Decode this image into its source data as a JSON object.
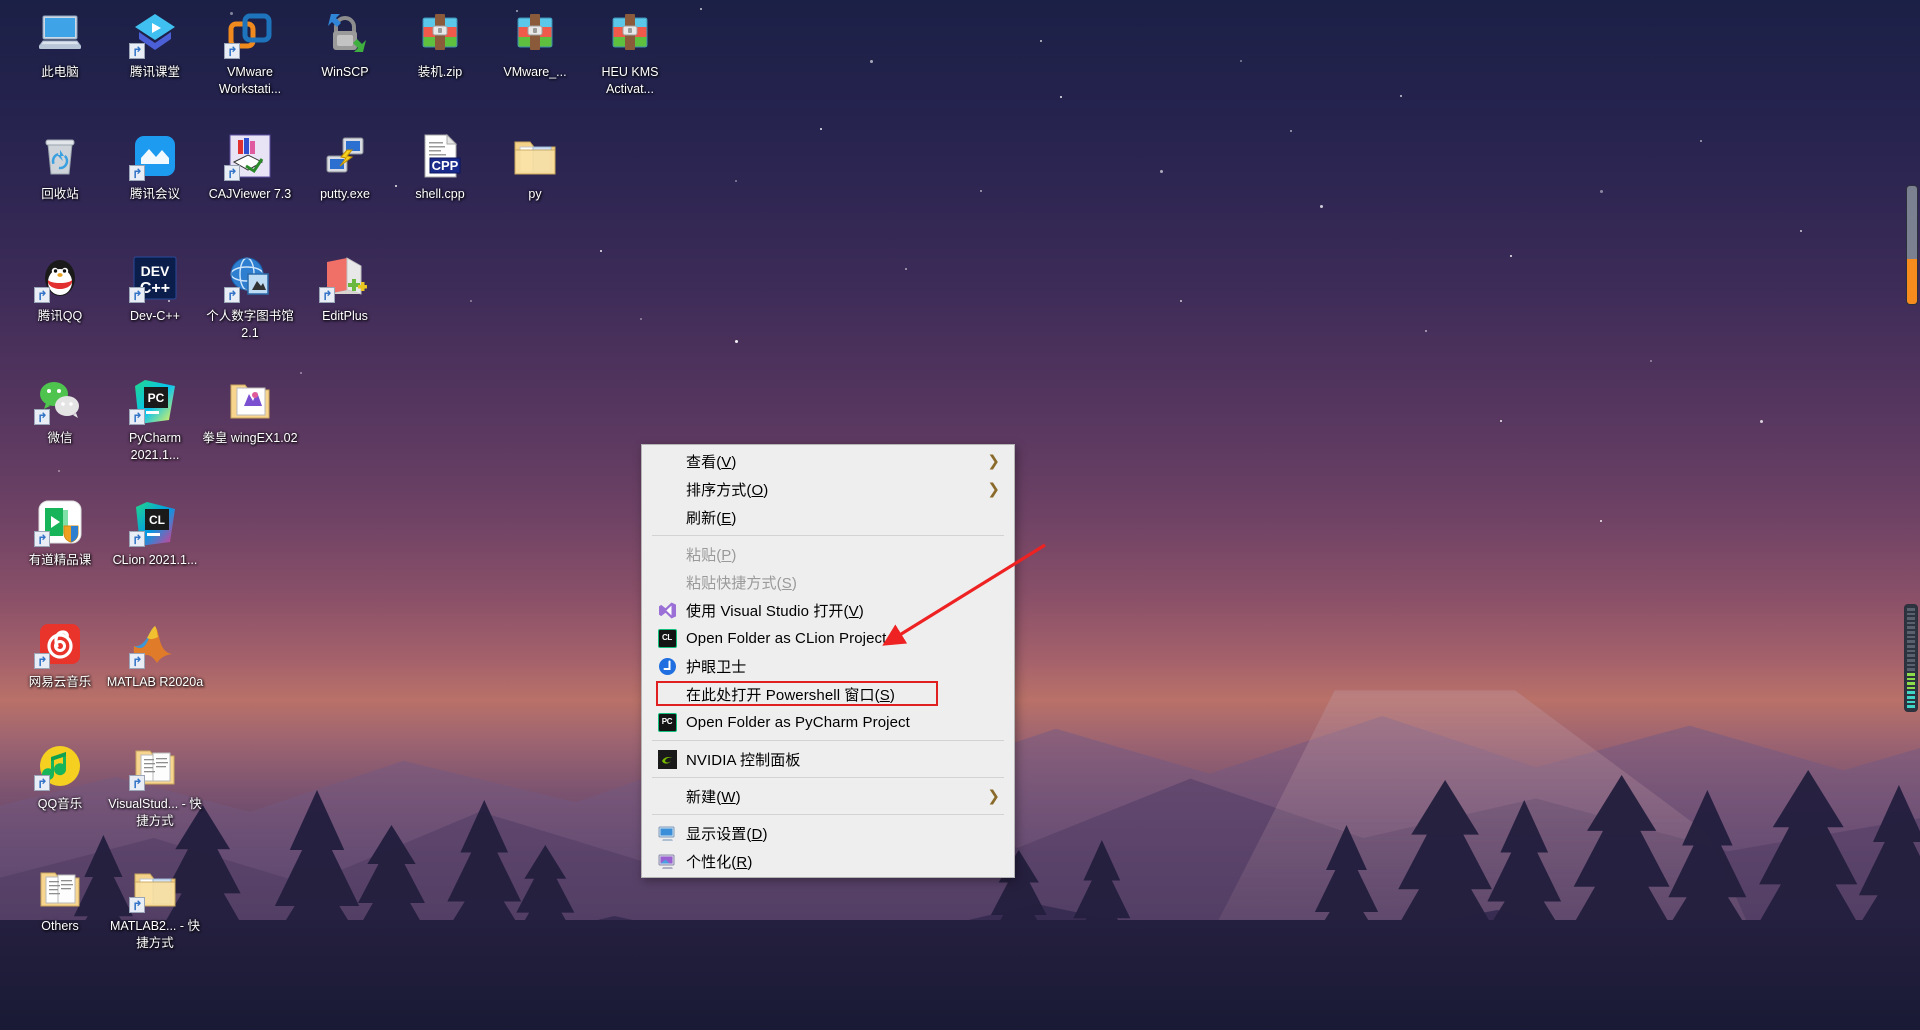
{
  "desktop": {
    "icons": [
      {
        "label": "此电脑",
        "name": "this-pc",
        "kind": "computer",
        "col": 0,
        "row": 0
      },
      {
        "label": "腾讯课堂",
        "name": "tencent-classroom",
        "kind": "tencent-classroom",
        "col": 1,
        "row": 0
      },
      {
        "label": "VMware Workstati...",
        "name": "vmware-workstation",
        "kind": "vmware",
        "col": 2,
        "row": 0
      },
      {
        "label": "WinSCP",
        "name": "winscp",
        "kind": "winscp",
        "col": 3,
        "row": 0
      },
      {
        "label": "装机.zip",
        "name": "zhuangji-zip",
        "kind": "winrar",
        "col": 4,
        "row": 0
      },
      {
        "label": "VMware_...",
        "name": "vmware-archive",
        "kind": "winrar",
        "col": 5,
        "row": 0
      },
      {
        "label": "HEU KMS Activat...",
        "name": "heu-kms-activator",
        "kind": "winrar",
        "col": 6,
        "row": 0
      },
      {
        "label": "回收站",
        "name": "recycle-bin",
        "kind": "recycle",
        "col": 0,
        "row": 1
      },
      {
        "label": "腾讯会议",
        "name": "tencent-meeting",
        "kind": "tencent-meeting",
        "col": 1,
        "row": 1
      },
      {
        "label": "CAJViewer 7.3",
        "name": "cajviewer",
        "kind": "cajviewer",
        "col": 2,
        "row": 1
      },
      {
        "label": "putty.exe",
        "name": "putty",
        "kind": "putty",
        "col": 3,
        "row": 1
      },
      {
        "label": "shell.cpp",
        "name": "shell-cpp",
        "kind": "cppfile",
        "col": 4,
        "row": 1
      },
      {
        "label": "py",
        "name": "py-folder",
        "kind": "folder",
        "col": 5,
        "row": 1
      },
      {
        "label": "腾讯QQ",
        "name": "tencent-qq",
        "kind": "qq",
        "col": 0,
        "row": 2
      },
      {
        "label": "Dev-C++",
        "name": "dev-cpp",
        "kind": "devcpp",
        "col": 1,
        "row": 2
      },
      {
        "label": "个人数字图书馆2.1",
        "name": "personal-digital-library",
        "kind": "globe",
        "col": 2,
        "row": 2
      },
      {
        "label": "EditPlus",
        "name": "editplus",
        "kind": "editplus",
        "col": 3,
        "row": 2
      },
      {
        "label": "微信",
        "name": "wechat",
        "kind": "wechat",
        "col": 0,
        "row": 3
      },
      {
        "label": "PyCharm 2021.1...",
        "name": "pycharm",
        "kind": "pycharm",
        "col": 1,
        "row": 3
      },
      {
        "label": "拳皇 wingEX1.02",
        "name": "kof-wingex",
        "kind": "folder-game",
        "col": 2,
        "row": 3
      },
      {
        "label": "有道精品课",
        "name": "youdao-course",
        "kind": "youdao",
        "col": 0,
        "row": 4
      },
      {
        "label": "CLion 2021.1...",
        "name": "clion",
        "kind": "clion",
        "col": 1,
        "row": 4
      },
      {
        "label": "网易云音乐",
        "name": "netease-music",
        "kind": "netease",
        "col": 0,
        "row": 5
      },
      {
        "label": "MATLAB R2020a",
        "name": "matlab",
        "kind": "matlab",
        "col": 1,
        "row": 5
      },
      {
        "label": "QQ音乐",
        "name": "qq-music",
        "kind": "qqmusic",
        "col": 0,
        "row": 6
      },
      {
        "label": "VisualStud... - 快捷方式",
        "name": "visualstudio-folder-shortcut",
        "kind": "folder-docs",
        "col": 1,
        "row": 6
      },
      {
        "label": "Others",
        "name": "others-folder",
        "kind": "folder-docs",
        "col": 0,
        "row": 7
      },
      {
        "label": "MATLAB2... - 快捷方式",
        "name": "matlab-folder-shortcut",
        "kind": "folder",
        "col": 1,
        "row": 7
      }
    ]
  },
  "context_menu": {
    "items": [
      {
        "label": "查看(V)",
        "accel": "V",
        "icon": "",
        "submenu": true,
        "disabled": false,
        "highlighted": false,
        "name": "view"
      },
      {
        "label": "排序方式(O)",
        "accel": "O",
        "icon": "",
        "submenu": true,
        "disabled": false,
        "highlighted": false,
        "name": "sort-by"
      },
      {
        "label": "刷新(E)",
        "accel": "E",
        "icon": "",
        "submenu": false,
        "disabled": false,
        "highlighted": false,
        "name": "refresh"
      },
      {
        "separator": true
      },
      {
        "label": "粘贴(P)",
        "accel": "P",
        "icon": "",
        "submenu": false,
        "disabled": true,
        "highlighted": false,
        "name": "paste"
      },
      {
        "label": "粘贴快捷方式(S)",
        "accel": "S",
        "icon": "",
        "submenu": false,
        "disabled": true,
        "highlighted": false,
        "name": "paste-shortcut"
      },
      {
        "label": "使用 Visual Studio 打开(V)",
        "accel": "V",
        "icon": "visual-studio",
        "submenu": false,
        "disabled": false,
        "highlighted": false,
        "name": "open-with-visual-studio"
      },
      {
        "label": "Open Folder as CLion Project",
        "accel": "",
        "icon": "clion",
        "submenu": false,
        "disabled": false,
        "highlighted": false,
        "name": "open-folder-as-clion-project"
      },
      {
        "label": "护眼卫士",
        "accel": "",
        "icon": "eye-guard",
        "submenu": false,
        "disabled": false,
        "highlighted": false,
        "name": "eye-guard"
      },
      {
        "label": "在此处打开 Powershell 窗口(S)",
        "accel": "S",
        "icon": "",
        "submenu": false,
        "disabled": false,
        "highlighted": true,
        "name": "open-powershell-window-here"
      },
      {
        "label": "Open Folder as PyCharm Project",
        "accel": "",
        "icon": "pycharm",
        "submenu": false,
        "disabled": false,
        "highlighted": false,
        "name": "open-folder-as-pycharm-project"
      },
      {
        "separator": true
      },
      {
        "label": "NVIDIA 控制面板",
        "accel": "",
        "icon": "nvidia",
        "submenu": false,
        "disabled": false,
        "highlighted": false,
        "name": "nvidia-control-panel"
      },
      {
        "separator": true
      },
      {
        "label": "新建(W)",
        "accel": "W",
        "icon": "",
        "submenu": true,
        "disabled": false,
        "highlighted": false,
        "name": "new"
      },
      {
        "separator": true
      },
      {
        "label": "显示设置(D)",
        "accel": "D",
        "icon": "display",
        "submenu": false,
        "disabled": false,
        "highlighted": false,
        "name": "display-settings"
      },
      {
        "label": "个性化(R)",
        "accel": "R",
        "icon": "personalize",
        "submenu": false,
        "disabled": false,
        "highlighted": false,
        "name": "personalize"
      }
    ],
    "submenu_arrow": "❯"
  },
  "annotation": {
    "arrow_color": "#ee2222",
    "highlight_color": "#e02020"
  },
  "gadgets": {
    "scroll_gadget_name": "vertical-meter-gadget",
    "level_gadget_name": "level-meter-gadget"
  }
}
